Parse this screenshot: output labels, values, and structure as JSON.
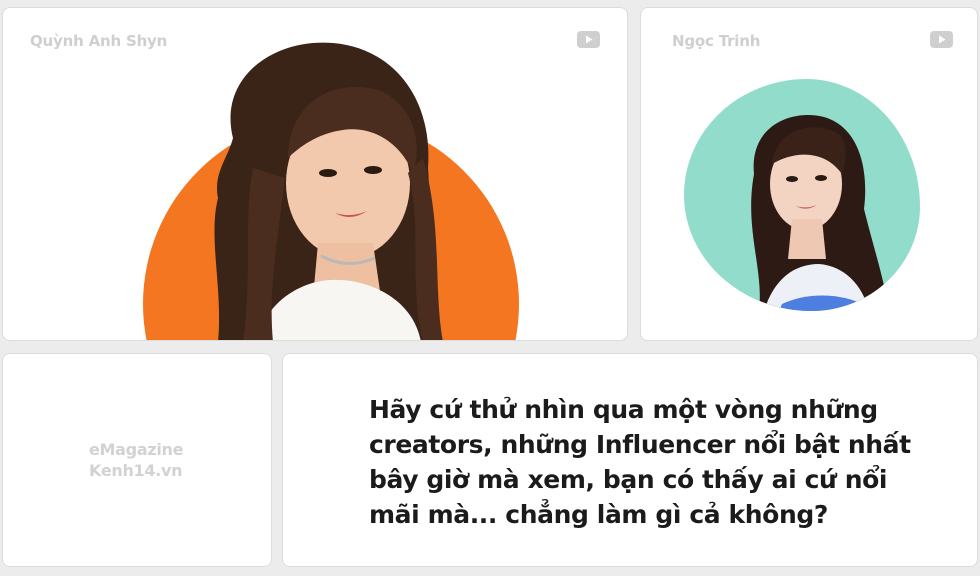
{
  "profiles": [
    {
      "name": "Quỳnh Anh Shyn",
      "platform_icon": "youtube-icon",
      "accent": "#f47621"
    },
    {
      "name": "Ngọc Trinh",
      "platform_icon": "youtube-icon",
      "accent": "#92dccc"
    }
  ],
  "brand": {
    "line1": "eMagazine",
    "line2": "Kenh14.vn"
  },
  "quote": {
    "text": "Hãy cứ thử nhìn qua một vòng những creators, những Influencer nổi bật nhất bây giờ mà xem, bạn có thấy ai cứ nổi mãi mà... chẳng làm gì cả không?"
  }
}
